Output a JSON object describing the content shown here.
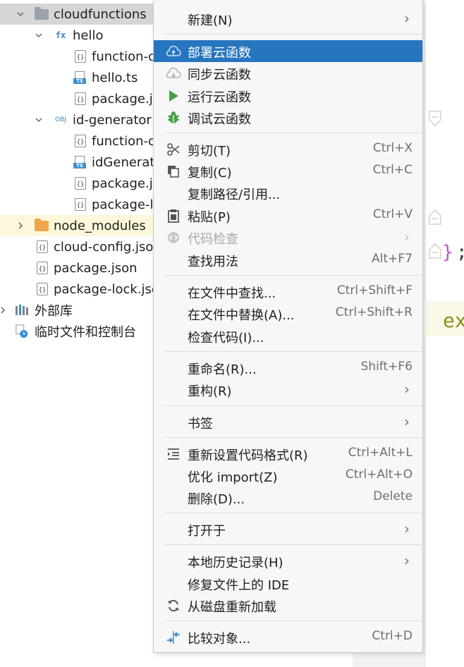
{
  "tree": {
    "items": [
      {
        "label": "cloudfunctions"
      },
      {
        "label": "hello"
      },
      {
        "label": "function-c"
      },
      {
        "label": "hello.ts"
      },
      {
        "label": "package.js"
      },
      {
        "label": "id-generator"
      },
      {
        "label": "function-c"
      },
      {
        "label": "idGenerat"
      },
      {
        "label": "package.js"
      },
      {
        "label": "package-l"
      },
      {
        "label": "node_modules"
      },
      {
        "label": "cloud-config.json"
      },
      {
        "label": "package.json"
      },
      {
        "label": "package-lock.json"
      },
      {
        "label": "外部库"
      },
      {
        "label": "临时文件和控制台"
      }
    ],
    "icons": {
      "fx": "fx",
      "obj": "OBJ",
      "ts": "TS",
      "json": "{}"
    }
  },
  "menu": {
    "items": [
      {
        "label": "新建(N)",
        "shortcut": ""
      },
      {
        "label": "部署云函数",
        "shortcut": ""
      },
      {
        "label": "同步云函数",
        "shortcut": ""
      },
      {
        "label": "运行云函数",
        "shortcut": ""
      },
      {
        "label": "调试云函数",
        "shortcut": ""
      },
      {
        "label": "剪切(T)",
        "shortcut": "Ctrl+X"
      },
      {
        "label": "复制(C)",
        "shortcut": "Ctrl+C"
      },
      {
        "label": "复制路径/引用...",
        "shortcut": ""
      },
      {
        "label": "粘贴(P)",
        "shortcut": "Ctrl+V"
      },
      {
        "label": "代码检查",
        "shortcut": ""
      },
      {
        "label": "查找用法",
        "shortcut": "Alt+F7"
      },
      {
        "label": "在文件中查找...",
        "shortcut": "Ctrl+Shift+F"
      },
      {
        "label": "在文件中替换(A)...",
        "shortcut": "Ctrl+Shift+R"
      },
      {
        "label": "检查代码(I)...",
        "shortcut": ""
      },
      {
        "label": "重命名(R)...",
        "shortcut": "Shift+F6"
      },
      {
        "label": "重构(R)",
        "shortcut": ""
      },
      {
        "label": "书签",
        "shortcut": ""
      },
      {
        "label": "重新设置代码格式(R)",
        "shortcut": "Ctrl+Alt+L"
      },
      {
        "label": "优化 import(Z)",
        "shortcut": "Ctrl+Alt+O"
      },
      {
        "label": "删除(D)...",
        "shortcut": "Delete"
      },
      {
        "label": "打开于",
        "shortcut": ""
      },
      {
        "label": "本地历史记录(H)",
        "shortcut": ""
      },
      {
        "label": "修复文件上的 IDE",
        "shortcut": ""
      },
      {
        "label": "从磁盘重新加载",
        "shortcut": ""
      },
      {
        "label": "比较对象...",
        "shortcut": "Ctrl+D"
      }
    ],
    "submenu_arrow": "›"
  },
  "editor": {
    "brace": "}",
    "semicolon": ";",
    "code_fragment": "ex"
  },
  "colors": {
    "menu_highlight": "#2675bf",
    "run_green": "#4aa04a",
    "debug_green": "#4aa04a",
    "folder_gray": "#9aa3ad",
    "folder_orange": "#f2a54a"
  }
}
